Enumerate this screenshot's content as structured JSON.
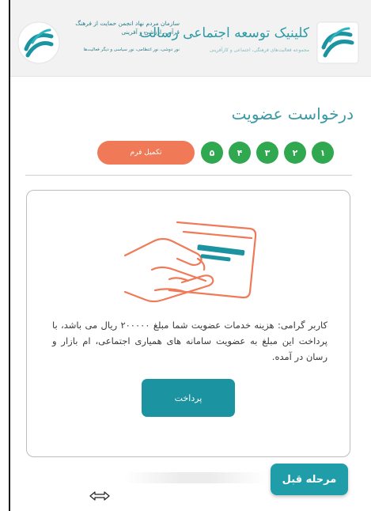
{
  "header": {
    "right_logo_icon": "resalat-logo-icon",
    "right_title": "کلینیک توسعه اجتماعی رسالت",
    "right_subtitle": "مجموعه فعالیت‌های فرهنگی، اجتماعی و کارآفرینی",
    "left_logo_icon": "resalat-logo-icon",
    "left_org": "سازمان مردم نهاد انجمن حمایت از فرهنگ قرآنی، ارزشی و آفرینی",
    "left_subtitle": "نور دوشی، نور انتظامی، نور سیاسی و دیگر فعالیت‌ها"
  },
  "page_title": "درخواست عضویت",
  "steps": {
    "items": [
      "۱",
      "۲",
      "۳",
      "۴",
      "۵"
    ],
    "current_label": "تکمیل فرم",
    "colors": {
      "done": "#2fa84f",
      "current": "#f07a57"
    }
  },
  "card": {
    "illustration_icon": "hand-holding-card-icon",
    "message": "کاربر گرامی: هزینه خدمات عضویت شما مبلغ ۲۰۰۰۰۰ ریال می باشد، با پرداخت این مبلغ به عضویت سامانه های همیاری اجتماعی، ام بازار و رسان در آمده.",
    "pay_button": "پرداخت"
  },
  "footer": {
    "prev_button": "مرحله قبل"
  },
  "colors": {
    "accent": "#1b93a0",
    "title": "#3b9aa6",
    "illustration": "#f07a57"
  }
}
